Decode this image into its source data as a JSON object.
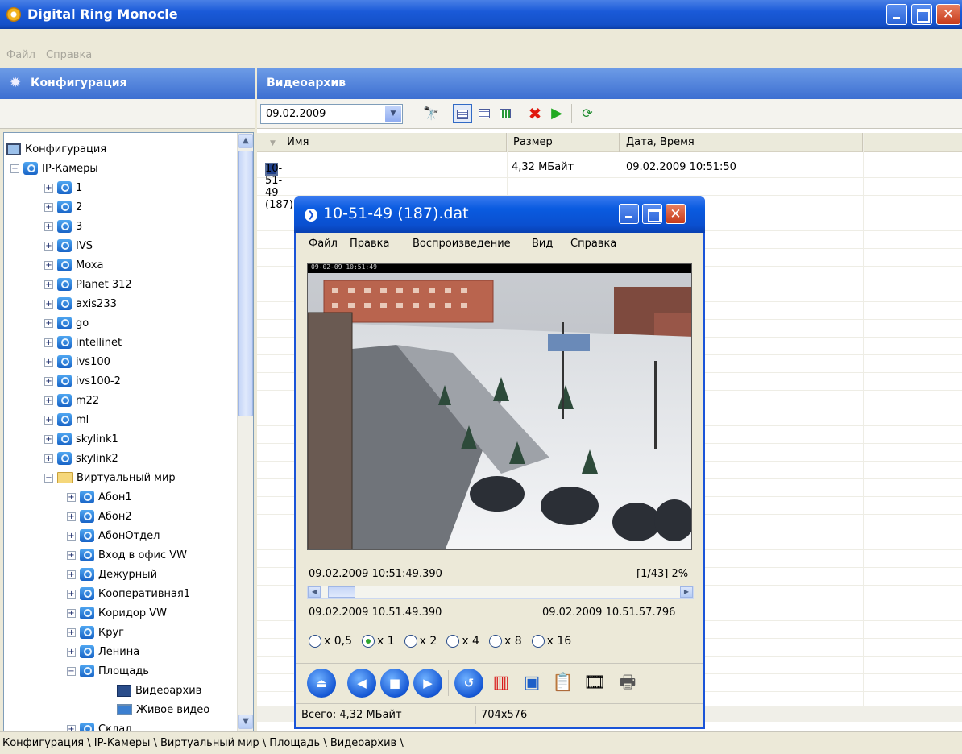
{
  "window": {
    "title": "Digital Ring Monocle"
  },
  "menu": {
    "file": "Файл",
    "help": "Справка"
  },
  "left_panel": {
    "title": "Конфигурация"
  },
  "tree": {
    "root": "Конфигурация",
    "group": "IP-Камеры",
    "cameras": [
      "1",
      "2",
      "3",
      "IVS",
      "Moxa",
      "Planet 312",
      "axis233",
      "go",
      "intellinet",
      "ivs100",
      "ivs100-2",
      "m22",
      "ml",
      "skylink1",
      "skylink2"
    ],
    "folder": "Виртуальный мир",
    "folder_cameras": [
      "Абон1",
      "Абон2",
      "АбонОтдел",
      "Вход в офис VW",
      "Дежурный",
      "Кооперативная1",
      "Коридор VW",
      "Круг",
      "Ленина",
      "Площадь"
    ],
    "leaf_archive": "Видеоархив",
    "leaf_live": "Живое видео",
    "next_item": "Склад"
  },
  "right_panel": {
    "title": "Видеоархив"
  },
  "toolbar": {
    "date": "09.02.2009"
  },
  "file_list": {
    "columns": [
      "Имя",
      "Размер",
      "Дата, Время"
    ],
    "rows": [
      {
        "name": "10-51-49 (187)",
        "size": "4,32 МБайт",
        "datetime": "09.02.2009 10:51:50"
      }
    ]
  },
  "status_bar": {
    "path": "Конфигурация \\ IP-Камеры \\ Виртуальный мир \\ Площадь \\ Видеоархив \\"
  },
  "player": {
    "title": "10-51-49 (187).dat",
    "menu": [
      "Файл",
      "Правка",
      "Воспроизведение",
      "Вид",
      "Справка"
    ],
    "current_time": "09.02.2009 10:51:49.390",
    "frame_info": "[1/43] 2%",
    "position_fraction": 0.02,
    "start_time": "09.02.2009 10.51.49.390",
    "end_time": "09.02.2009 10.51.57.796",
    "speeds": [
      "x 0,5",
      "x 1",
      "x 2",
      "x 4",
      "x 8",
      "x 16"
    ],
    "selected_speed": "x 1",
    "status_total": "Всего: 4,32 МБайт",
    "status_resolution": "704x576"
  },
  "colors": {
    "titlebar": "#1a5ad8",
    "panel_header": "#5080dc",
    "window_bg": "#ece9d8"
  }
}
